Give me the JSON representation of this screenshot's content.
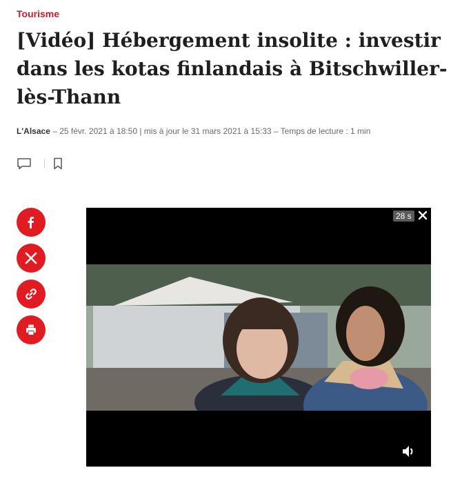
{
  "article": {
    "category": "Tourisme",
    "title": "[Vidéo] Hébergement insolite : investir dans les kotas finlandais à Bitschwiller-lès-Thann",
    "source": "L'Alsace",
    "meta_text": " – 25 févr. 2021 à 18:50 | mis à jour le 31 mars 2021 à 15:33 – Temps de lecture : 1 min"
  },
  "share": {
    "items": [
      {
        "icon": "facebook-icon"
      },
      {
        "icon": "x-icon"
      },
      {
        "icon": "link-icon"
      },
      {
        "icon": "print-icon"
      }
    ]
  },
  "video": {
    "countdown": "28 s"
  },
  "colors": {
    "accent": "#e11b22",
    "category": "#d11a2a"
  }
}
